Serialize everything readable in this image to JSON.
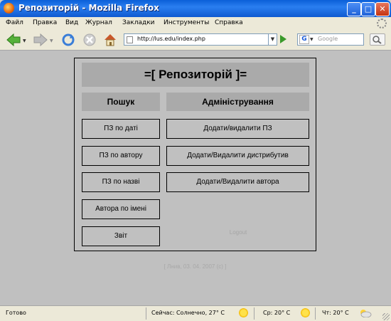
{
  "window": {
    "title": "Репозиторій - Mozilla Firefox",
    "minimize": "_",
    "maximize": "□",
    "close": "✕"
  },
  "menu": [
    "Файл",
    "Правка",
    "Вид",
    "Журнал",
    "Закладки",
    "Инструменты",
    "Справка"
  ],
  "nav": {
    "url": "http://lus.edu/index.php",
    "search_engine": "G",
    "search_placeholder": "Google"
  },
  "page": {
    "title": "=[ Репозиторій ]=",
    "search_heading": "Пошук",
    "admin_heading": "Адміністрування",
    "search_buttons": [
      "ПЗ по даті",
      "ПЗ по автору",
      "ПЗ по назві",
      "Автора по імені",
      "Звіт"
    ],
    "admin_buttons": [
      "Додати/видалити ПЗ",
      "Додати/Видалити дистрибутив",
      "Додати/Видалити автора"
    ],
    "login": "Logout",
    "footer": "[ Лнив, 03. 04. 2007 (c) ]"
  },
  "status": {
    "left": "Готово",
    "weather_now": "Сейчас: Солнечно, 27° C",
    "weather_wed": "Ср: 20° C",
    "weather_thu": "Чт: 20° C"
  },
  "colors": {
    "titlebar": "#0a5fd8",
    "content_bg": "#c0c0c0",
    "heading_bg": "#aaaaaa"
  },
  "icons": [
    "firefox-icon",
    "back-icon",
    "forward-icon",
    "reload-icon",
    "stop-icon",
    "home-icon",
    "page-icon",
    "go-icon",
    "google-icon",
    "search-go-icon",
    "sun-icon",
    "cloud-icon"
  ]
}
